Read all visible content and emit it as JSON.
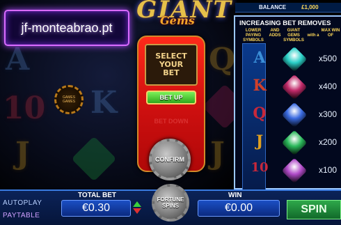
{
  "game": {
    "logo_main": "GIANT",
    "logo_sub": "Gems"
  },
  "watermark": "jf-monteabrao.pt",
  "coin_badge": "GAMES GAMES",
  "balance": {
    "label": "BALANCE",
    "value": "£1,000"
  },
  "bet_panel": {
    "select_text": "SELECT\nYOUR\nBET",
    "bet_up": "BET UP",
    "bet_down": "BET DOWN",
    "confirm": "CONFIRM"
  },
  "paytable": {
    "title": "INCREASING BET REMOVES",
    "col_lower": "LOWER\nPAYING\nSYMBOLS",
    "col_and": "AND\nADDS",
    "col_giant": "GIANT\nGEMS\nSYMBOLS",
    "col_with": "with a",
    "col_max": "MAX WIN\nOF",
    "rows": [
      {
        "symbol": "A",
        "gem_color": "#2ad0c8",
        "letter_color": "#3b8fd8",
        "value": "x500"
      },
      {
        "symbol": "K",
        "gem_color": "#c22a6a",
        "letter_color": "#d0402a",
        "value": "x400"
      },
      {
        "symbol": "Q",
        "gem_color": "#3a6ae0",
        "letter_color": "#c8283a",
        "value": "x300"
      },
      {
        "symbol": "J",
        "gem_color": "#2ab85a",
        "letter_color": "#e0a020",
        "value": "x200"
      },
      {
        "symbol": "10",
        "gem_color": "#b04ac8",
        "letter_color": "#c8283a",
        "value": "x100"
      }
    ]
  },
  "bottom": {
    "autoplay": "AUTOPLAY",
    "paytable": "PAYTABLE",
    "total_bet_label": "TOTAL BET",
    "total_bet_value": "€0.30",
    "fortune_spins": "FORTUNE\nSPINS",
    "win_label": "WIN",
    "win_value": "€0.00",
    "spin": "SPIN"
  },
  "colors": {
    "accent_blue": "#1b4fc4",
    "bet_panel_red": "#d01010",
    "bet_up_green": "#2ea81c",
    "spin_green": "#2ea84a"
  }
}
